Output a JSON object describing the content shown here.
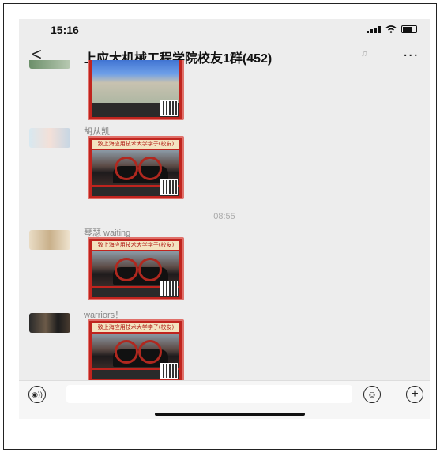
{
  "status": {
    "time": "15:16"
  },
  "nav": {
    "back_label": "<",
    "title": "上应大机械工程学院校友1群(452)",
    "more_label": "..."
  },
  "messages": [
    {
      "sender": "",
      "content": "campus-poster-image"
    },
    {
      "sender": "胡从凯",
      "content": "locomotive-poster-image"
    },
    {
      "timestamp": "08:55"
    },
    {
      "sender": "琴瑟 waiting",
      "content": "locomotive-poster-image"
    },
    {
      "sender": "warriors！",
      "content": "locomotive-poster-image"
    }
  ],
  "poster_banner": "致上海应用技术大学学子(校友)",
  "input": {
    "placeholder": ""
  },
  "icons": {
    "back": "chevron-left-icon",
    "mute": "mute-icon",
    "more": "more-icon",
    "voice": "voice-icon",
    "emoji": "emoji-icon",
    "plus": "plus-icon"
  },
  "colors": {
    "poster_red": "#c0241e",
    "background": "#ededed"
  }
}
